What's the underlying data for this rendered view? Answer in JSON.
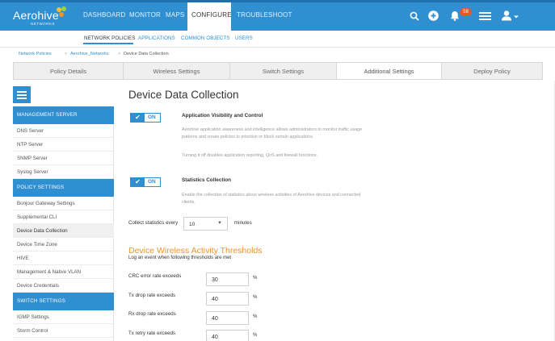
{
  "app": {
    "logo_text": "Aerohive",
    "logo_subtext": "NETWORKS",
    "nav": [
      "DASHBOARD",
      "MONITOR",
      "MAPS",
      "CONFIGURE",
      "TROUBLESHOOT"
    ],
    "nav_active": "CONFIGURE",
    "notification_count": "58"
  },
  "subnav": {
    "items": [
      "NETWORK POLICIES",
      "APPLICATIONS",
      "COMMON OBJECTS",
      "USERS"
    ],
    "active": "NETWORK POLICIES"
  },
  "breadcrumb": {
    "items": [
      "Network Policies",
      "Aerohive_Networks",
      "Device Data Collection"
    ]
  },
  "steps": [
    "Policy Details",
    "Wireless Settings",
    "Switch Settings",
    "Additional Settings",
    "Deploy Policy"
  ],
  "steps_active": "Additional Settings",
  "sidebar": {
    "sections": [
      {
        "header": "MANAGEMENT SERVER",
        "items": [
          "DNS Server",
          "NTP Server",
          "SNMP Server",
          "Syslog Server"
        ]
      },
      {
        "header": "POLICY SETTINGS",
        "items": [
          "Bonjour Gateway Settings",
          "Supplemental CLI",
          "Device Data Collection",
          "Device Time Zone",
          "HIVE",
          "Management & Native VLAN",
          "Device Credentials"
        ]
      },
      {
        "header": "SWITCH SETTINGS",
        "items": [
          "IGMP Settings",
          "Storm Control"
        ]
      }
    ],
    "selected": "Device Data Collection"
  },
  "main": {
    "title": "Device Data Collection",
    "avc": {
      "toggle": "ON",
      "title": "Application Visibility and Control",
      "desc1": "Aerohive application awareness and intelligence allows administrators to monitor traffic usage patterns and create policies to prioritize or block certain applications.",
      "desc2": "Turning it off disables application reporting, QoS and firewall functions."
    },
    "stats": {
      "toggle": "ON",
      "title": "Statistics Collection",
      "desc": "Enable the collection of statistics about wireless activities of Aerohive devices and connected clients."
    },
    "collect": {
      "label": "Collect statistics every",
      "value": "10",
      "unit": "minutes"
    },
    "thresholds": {
      "title": "Device Wireless Activity Thresholds",
      "subtitle": "Log an event when following thresholds are met",
      "rows": [
        {
          "label": "CRC error rate exceeds",
          "value": "30",
          "unit": "%"
        },
        {
          "label": "Tx drop rate exceeds",
          "value": "40",
          "unit": "%"
        },
        {
          "label": "Rx drop rate exceeds",
          "value": "40",
          "unit": "%"
        },
        {
          "label": "Tx retry rate exceeds",
          "value": "40",
          "unit": "%"
        }
      ]
    }
  },
  "colors": {
    "brand": "#2f8fd0",
    "accent": "#f0932b",
    "badge": "#e05a2a"
  }
}
